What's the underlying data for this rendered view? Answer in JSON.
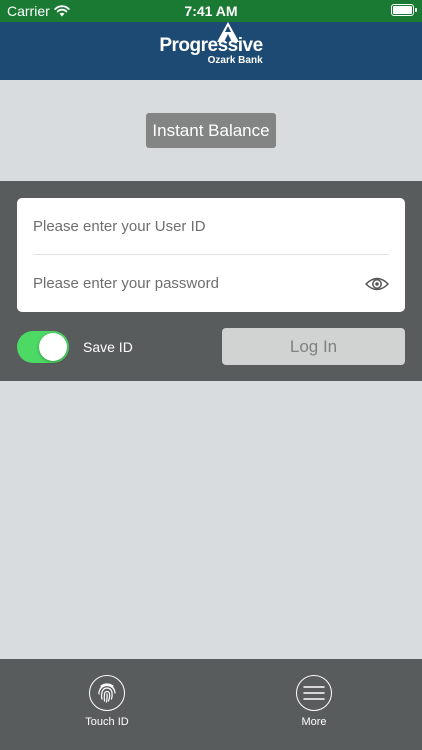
{
  "status_bar": {
    "carrier": "Carrier",
    "time": "7:41 AM"
  },
  "header": {
    "logo_name": "Progressive",
    "logo_sub": "Ozark Bank"
  },
  "balance": {
    "button_label": "Instant Balance"
  },
  "login": {
    "user_id_placeholder": "Please enter your User ID",
    "password_placeholder": "Please enter your password",
    "save_id_label": "Save ID",
    "save_id_enabled": true,
    "login_button_label": "Log In"
  },
  "tab_bar": {
    "items": [
      {
        "label": "Touch ID",
        "icon": "fingerprint-icon"
      },
      {
        "label": "More",
        "icon": "menu-icon"
      }
    ]
  },
  "colors": {
    "status_bar": "#1a7a33",
    "header": "#1d4a73",
    "panel": "#595c5d",
    "background": "#d8dcdf",
    "toggle_on": "#4cd964"
  }
}
